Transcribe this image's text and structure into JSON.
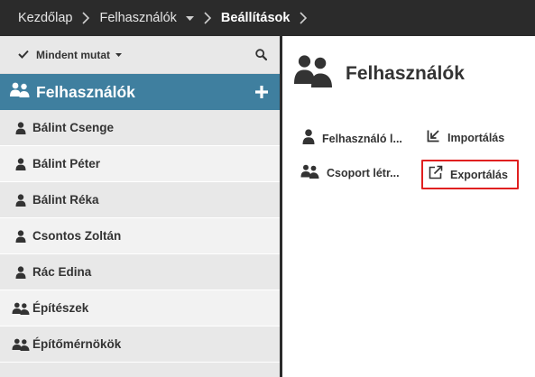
{
  "breadcrumb": {
    "items": [
      {
        "label": "Kezdőlap"
      },
      {
        "label": "Felhasználók"
      },
      {
        "label": "Beállítások"
      }
    ]
  },
  "filter": {
    "label": "Mindent mutat"
  },
  "list": {
    "title": "Felhasználók",
    "items": [
      {
        "label": "Bálint Csenge",
        "icon": "user-icon"
      },
      {
        "label": "Bálint Péter",
        "icon": "user-icon"
      },
      {
        "label": "Bálint Réka",
        "icon": "user-icon"
      },
      {
        "label": "Csontos Zoltán",
        "icon": "user-icon"
      },
      {
        "label": "Rác Edina",
        "icon": "user-icon"
      },
      {
        "label": "Építészek",
        "icon": "group-icon"
      },
      {
        "label": "Építőmérnökök",
        "icon": "group-icon"
      }
    ]
  },
  "panel": {
    "title": "Felhasználók",
    "actions": [
      {
        "label": "Felhasználó l...",
        "icon": "user-icon"
      },
      {
        "label": "Importálás",
        "icon": "import-icon"
      },
      {
        "label": "Csoport létr...",
        "icon": "group-icon"
      },
      {
        "label": "Exportálás",
        "icon": "export-icon"
      }
    ]
  },
  "colors": {
    "topbar": "#2b2b2b",
    "list_header": "#3f7f9f",
    "highlight": "#e02020"
  }
}
